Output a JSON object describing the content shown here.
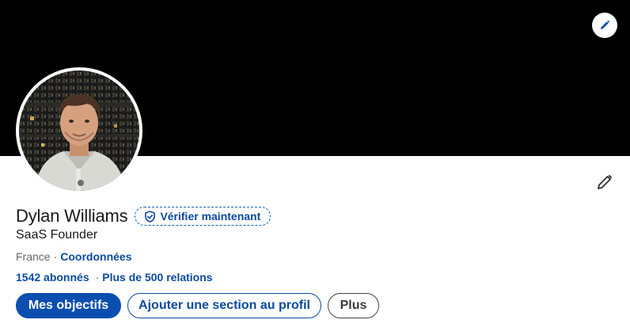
{
  "profile": {
    "name": "Dylan Williams",
    "verify_label": "Vérifier maintenant",
    "headline": "SaaS Founder",
    "location": "France",
    "location_separator": "·",
    "contact_link": "Coordonnées",
    "followers": "1542 abonnés",
    "stats_separator": "·",
    "connections": "Plus de 500 relations"
  },
  "actions": {
    "primary": "Mes objectifs",
    "add_section": "Ajouter une section au profil",
    "more": "Plus"
  },
  "icons": {
    "banner_edit": "pencil-icon",
    "profile_edit": "pencil-icon",
    "verify": "shield-check-icon"
  },
  "colors": {
    "banner": "#000000",
    "accent": "#0a4fb0",
    "link": "#0a4a9e",
    "text": "#191919",
    "muted": "#666666"
  }
}
